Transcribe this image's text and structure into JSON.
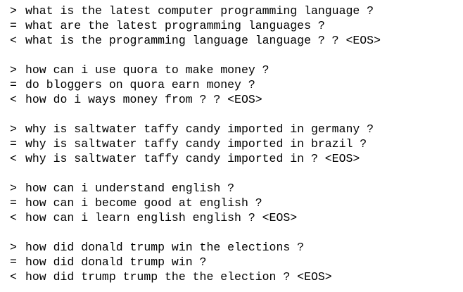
{
  "blocks": [
    {
      "input_prefix": ">",
      "input": "what is the latest computer programming language ?",
      "target_prefix": "=",
      "target": "what are the latest programming languages ?",
      "output_prefix": "<",
      "output": "what is the programming language language ? ? <EOS>"
    },
    {
      "input_prefix": ">",
      "input": "how can i use quora to make money ?",
      "target_prefix": "=",
      "target": "do bloggers on quora earn money ?",
      "output_prefix": "<",
      "output": "how do i ways money from ? ? <EOS>"
    },
    {
      "input_prefix": ">",
      "input": "why is saltwater taffy candy imported in germany ?",
      "target_prefix": "=",
      "target": "why is saltwater taffy candy imported in brazil ?",
      "output_prefix": "<",
      "output": "why is saltwater taffy candy imported in ? <EOS>"
    },
    {
      "input_prefix": ">",
      "input": "how can i understand english ?",
      "target_prefix": "=",
      "target": "how can i become good at english ?",
      "output_prefix": "<",
      "output": "how can i learn english english ? <EOS>"
    },
    {
      "input_prefix": ">",
      "input": "how did donald trump win the elections ?",
      "target_prefix": "=",
      "target": "how did donald trump win ?",
      "output_prefix": "<",
      "output": "how did trump trump the the election ? <EOS>"
    }
  ]
}
